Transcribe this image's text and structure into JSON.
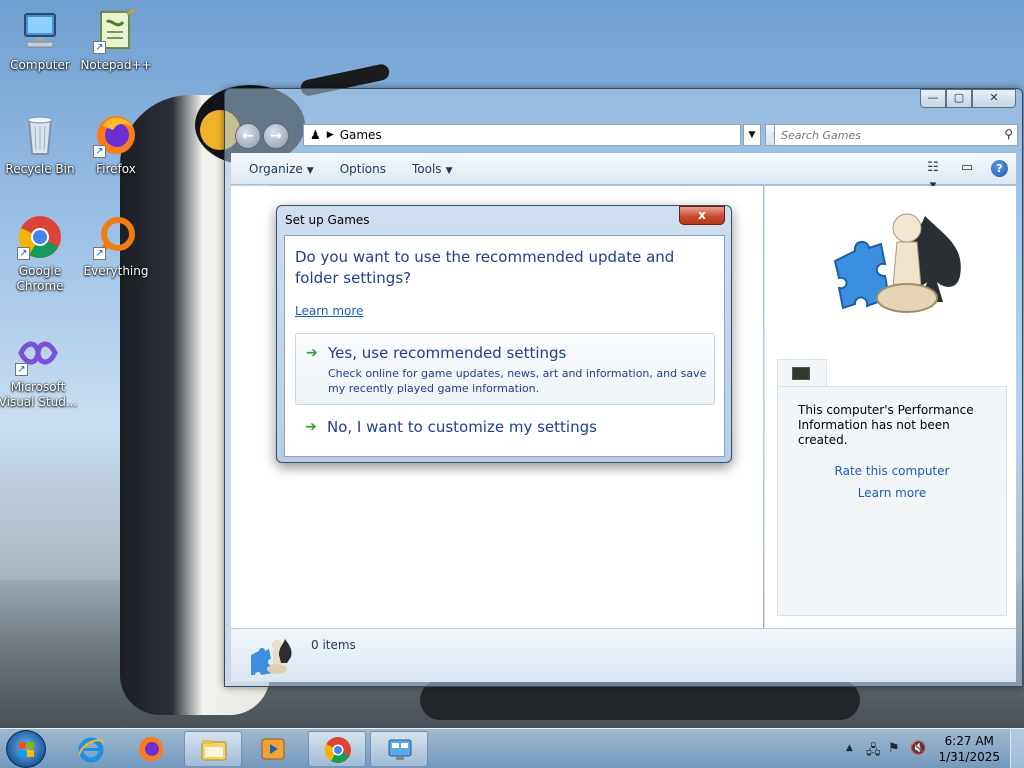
{
  "desktop": {
    "icons": [
      {
        "label": "Computer",
        "icon": "computer-icon"
      },
      {
        "label": "Notepad++",
        "icon": "notepadpp-icon"
      },
      {
        "label": "Recycle Bin",
        "icon": "recycle-bin-icon"
      },
      {
        "label": "Firefox",
        "icon": "firefox-icon"
      },
      {
        "label": "Google Chrome",
        "icon": "chrome-icon"
      },
      {
        "label": "Everything",
        "icon": "everything-icon"
      },
      {
        "label": "Microsoft Visual Stud...",
        "icon": "visual-studio-icon"
      }
    ]
  },
  "explorer": {
    "address": "Games",
    "search_placeholder": "Search Games",
    "toolbar": {
      "organize": "Organize",
      "options": "Options",
      "tools": "Tools"
    },
    "details": {
      "perf_text": "This computer's Performance Information has not been created.",
      "rate_link": "Rate this computer",
      "learn_link": "Learn more"
    },
    "status_text": "0 items"
  },
  "dialog": {
    "title": "Set up Games",
    "close": "x",
    "question": "Do you want to use the recommended update and folder settings?",
    "learn_more": "Learn more",
    "option_recommended": {
      "title": "Yes, use recommended settings",
      "desc": "Check online for game updates, news, art and information, and save my recently played game information."
    },
    "option_custom": {
      "title": "No, I want to customize my settings"
    }
  },
  "taskbar": {
    "clock_time": "6:27 AM",
    "clock_date": "1/31/2025",
    "pinned": [
      "internet-explorer-icon",
      "firefox-icon",
      "explorer-icon",
      "media-player-icon",
      "chrome-icon",
      "control-panel-icon"
    ]
  },
  "colors": {
    "link": "#1a5fb4",
    "dialog_text": "#1e3f8f",
    "close_red": "#c84a2f",
    "arrow_green": "#2e9d32"
  }
}
